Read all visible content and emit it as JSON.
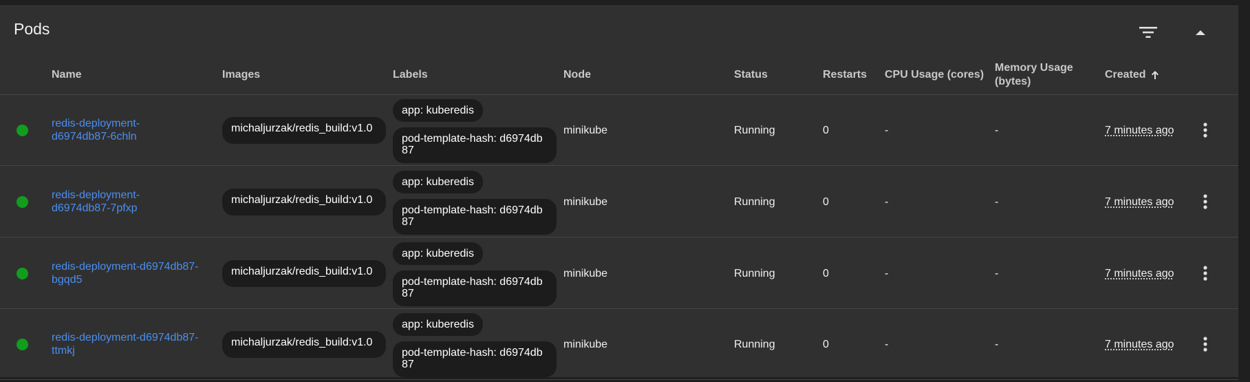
{
  "card": {
    "title": "Pods"
  },
  "columns": {
    "name": "Name",
    "images": "Images",
    "labels": "Labels",
    "node": "Node",
    "status": "Status",
    "restarts": "Restarts",
    "cpu": "CPU Usage (cores)",
    "memory": "Memory Usage (bytes)",
    "created": "Created"
  },
  "icons": {
    "filter": "filter-list-icon",
    "collapse": "expand-less-icon",
    "sort": "arrow-upward-icon",
    "row_menu": "more-vert-icon",
    "status": "status-dot-icon"
  },
  "colors": {
    "running": "#109e1c",
    "link": "#4a8ff0"
  },
  "pods": [
    {
      "name_line1": "redis-deployment-",
      "name_line2": "d6974db87-6chln",
      "image": "michaljurzak/redis_build:v1.0",
      "label_app": "app: kuberedis",
      "label_hash": "pod-template-hash: d6974db87",
      "node": "minikube",
      "status": "Running",
      "restarts": "0",
      "cpu": "-",
      "memory": "-",
      "created": "7 minutes ago"
    },
    {
      "name_line1": "redis-deployment-",
      "name_line2": "d6974db87-7pfxp",
      "image": "michaljurzak/redis_build:v1.0",
      "label_app": "app: kuberedis",
      "label_hash": "pod-template-hash: d6974db87",
      "node": "minikube",
      "status": "Running",
      "restarts": "0",
      "cpu": "-",
      "memory": "-",
      "created": "7 minutes ago"
    },
    {
      "name_line1": "redis-deployment-d6974db87-",
      "name_line2": "bgqd5",
      "image": "michaljurzak/redis_build:v1.0",
      "label_app": "app: kuberedis",
      "label_hash": "pod-template-hash: d6974db87",
      "node": "minikube",
      "status": "Running",
      "restarts": "0",
      "cpu": "-",
      "memory": "-",
      "created": "7 minutes ago"
    },
    {
      "name_line1": "redis-deployment-d6974db87-",
      "name_line2": "ttmkj",
      "image": "michaljurzak/redis_build:v1.0",
      "label_app": "app: kuberedis",
      "label_hash": "pod-template-hash: d6974db87",
      "node": "minikube",
      "status": "Running",
      "restarts": "0",
      "cpu": "-",
      "memory": "-",
      "created": "7 minutes ago"
    }
  ]
}
